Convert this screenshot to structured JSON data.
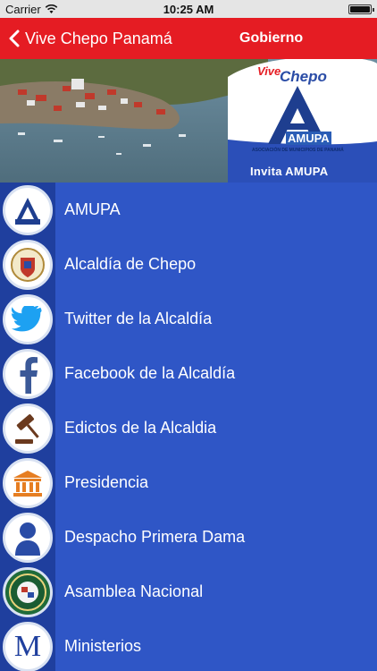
{
  "status": {
    "carrier": "Carrier",
    "time": "10:25 AM",
    "battery_level": 1.0
  },
  "nav": {
    "back_label": "Vive Chepo Panamá",
    "title": "Gobierno"
  },
  "banner": {
    "vive": "Vive",
    "chepo": "Chepo",
    "logo_text": "AMUPA",
    "association": "ASOCIACIÓN DE MUNICIPIOS DE PANAMÁ",
    "invite": "Invita  AMUPA"
  },
  "menu": [
    {
      "label": "AMUPA",
      "icon": "amupa-logo-icon"
    },
    {
      "label": "Alcaldía de Chepo",
      "icon": "chepo-crest-icon"
    },
    {
      "label": "Twitter de la Alcaldía",
      "icon": "twitter-icon"
    },
    {
      "label": "Facebook de la  Alcaldía",
      "icon": "facebook-icon"
    },
    {
      "label": "Edictos de la Alcaldia",
      "icon": "gavel-icon"
    },
    {
      "label": "Presidencia",
      "icon": "government-building-icon"
    },
    {
      "label": "Despacho Primera Dama",
      "icon": "person-silhouette-icon"
    },
    {
      "label": "Asamblea Nacional",
      "icon": "asamblea-seal-icon"
    },
    {
      "label": "Ministerios",
      "icon": "letter-m-icon"
    }
  ],
  "colors": {
    "nav_red": "#e51c23",
    "list_blue": "#2f56c6",
    "icon_column_blue": "#1f3f9e"
  }
}
